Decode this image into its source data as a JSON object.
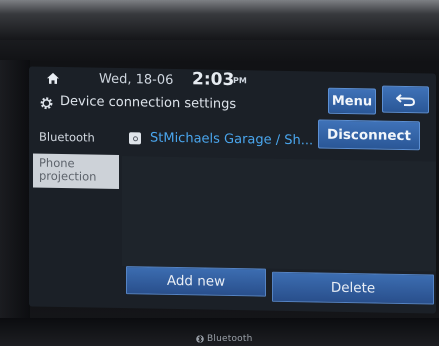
{
  "status": {
    "date": "Wed, 18-06",
    "time": "2:03",
    "ampm": "PM"
  },
  "header": {
    "title": "Device connection settings",
    "menu_label": "Menu",
    "back_icon": "back-arrow-icon",
    "settings_icon": "gear-icon",
    "home_icon": "home-icon"
  },
  "sidebar": {
    "items": [
      {
        "label": "Bluetooth",
        "selected": false
      },
      {
        "label": "Phone projection",
        "selected": true
      }
    ]
  },
  "device": {
    "name": "StMichaels Garage / Sh...",
    "icon": "device-icon",
    "disconnect_label": "Disconnect"
  },
  "actions": {
    "add_label": "Add new",
    "delete_label": "Delete"
  },
  "hardware": {
    "brand_label": "Bluetooth"
  },
  "colors": {
    "button_blue": "#2f62a6",
    "device_name": "#4aa6ee",
    "screen_bg": "#1b2027",
    "sidebar_selected": "#cdd2d8"
  }
}
